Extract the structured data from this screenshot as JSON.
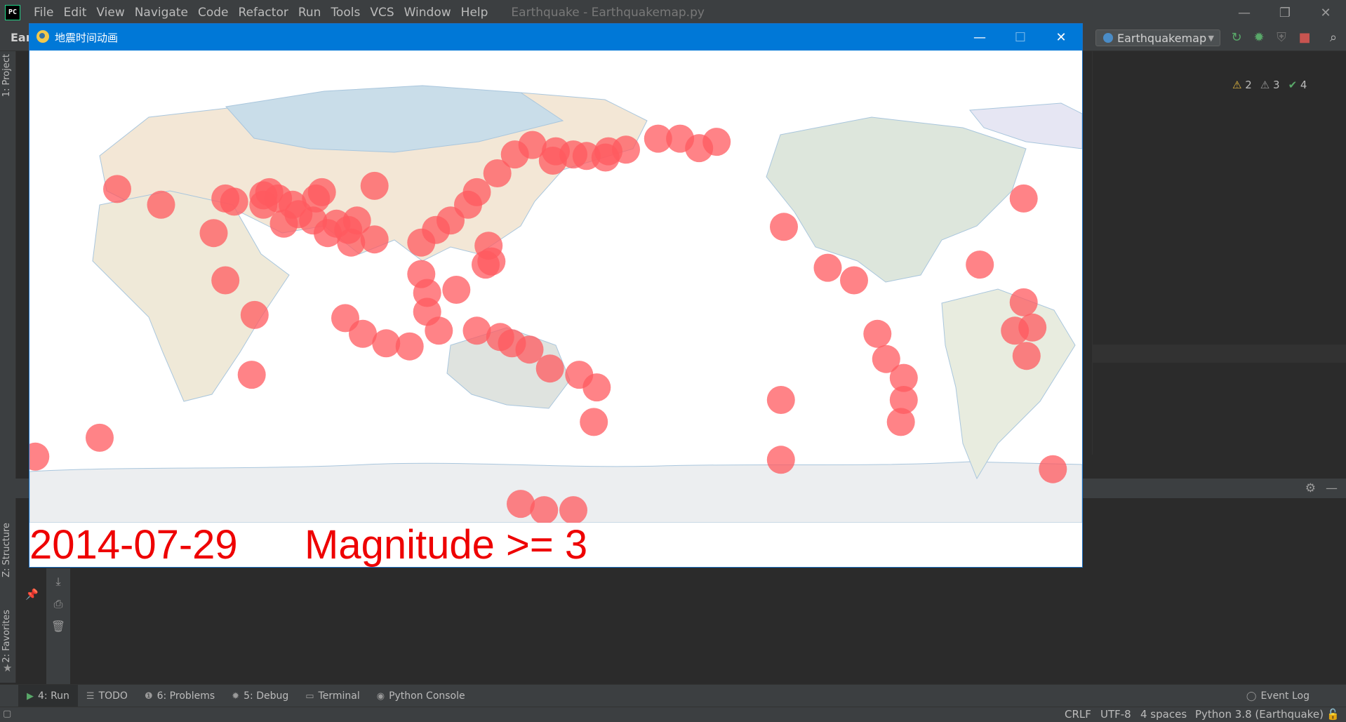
{
  "ide": {
    "menus": [
      "File",
      "Edit",
      "View",
      "Navigate",
      "Code",
      "Refactor",
      "Run",
      "Tools",
      "VCS",
      "Window",
      "Help"
    ],
    "window_title": "Earthquake - Earthquakemap.py",
    "project_crumb": "Ear",
    "run_config": "Earthquakemap",
    "inspections": {
      "warnings": "2",
      "weak_warnings": "3",
      "typos": "4"
    },
    "left_tabs": {
      "project": "1: Project",
      "structure": "Z: Structure",
      "favorites": "2: Favorites"
    },
    "tool_windows": [
      {
        "icon": "run-icon",
        "glyph": "▶",
        "label": "4: Run",
        "active": true
      },
      {
        "icon": "todo-icon",
        "glyph": "☰",
        "label": "TODO",
        "active": false
      },
      {
        "icon": "problems-icon",
        "glyph": "❶",
        "label": "6: Problems",
        "active": false
      },
      {
        "icon": "debug-icon",
        "glyph": "✹",
        "label": "5: Debug",
        "active": false
      },
      {
        "icon": "terminal-icon",
        "glyph": "▭",
        "label": "Terminal",
        "active": false
      },
      {
        "icon": "python-console-icon",
        "glyph": "◉",
        "label": "Python Console",
        "active": false
      }
    ],
    "event_log": "Event Log",
    "status": {
      "line_sep": "CRLF",
      "encoding": "UTF-8",
      "indent": "4 spaces",
      "interpreter": "Python 3.8 (Earthquake)"
    }
  },
  "animation": {
    "window_title": "地震时间动画",
    "date_label": "2014-07-29",
    "magnitude_label": "Magnitude >= 3",
    "marker_color": "#ff5a5f",
    "quakes": [
      {
        "lat": 53,
        "lon": 170
      },
      {
        "lat": 51.5,
        "lon": -179.5
      },
      {
        "lat": 52,
        "lon": 176
      },
      {
        "lat": 51,
        "lon": -173
      },
      {
        "lat": 53.5,
        "lon": -166
      },
      {
        "lat": 53,
        "lon": -172
      },
      {
        "lat": 57,
        "lon": -155
      },
      {
        "lat": 57,
        "lon": -147.5
      },
      {
        "lat": 54,
        "lon": -141
      },
      {
        "lat": 56,
        "lon": -135
      },
      {
        "lat": 46,
        "lon": 150
      },
      {
        "lat": 52,
        "lon": 156
      },
      {
        "lat": 40,
        "lon": 143
      },
      {
        "lat": 36,
        "lon": 140
      },
      {
        "lat": 31,
        "lon": 134
      },
      {
        "lat": 28,
        "lon": 129
      },
      {
        "lat": 24,
        "lon": 124
      },
      {
        "lat": 23,
        "lon": 147
      },
      {
        "lat": 17,
        "lon": 146
      },
      {
        "lat": 18,
        "lon": 148
      },
      {
        "lat": 14,
        "lon": 124
      },
      {
        "lat": 8,
        "lon": 126
      },
      {
        "lat": 2,
        "lon": 126
      },
      {
        "lat": 9,
        "lon": 136
      },
      {
        "lat": 0,
        "lon": 98
      },
      {
        "lat": -5,
        "lon": 104
      },
      {
        "lat": -8,
        "lon": 112
      },
      {
        "lat": -9,
        "lon": 120
      },
      {
        "lat": -4,
        "lon": 130
      },
      {
        "lat": -4,
        "lon": 143
      },
      {
        "lat": -6,
        "lon": 151
      },
      {
        "lat": -8,
        "lon": 155
      },
      {
        "lat": -10,
        "lon": 161
      },
      {
        "lat": -16,
        "lon": 168
      },
      {
        "lat": -18,
        "lon": 178
      },
      {
        "lat": -22,
        "lon": -176
      },
      {
        "lat": -33,
        "lon": -177
      },
      {
        "lat": 40,
        "lon": 72
      },
      {
        "lat": 39,
        "lon": 70
      },
      {
        "lat": 38,
        "lon": 75
      },
      {
        "lat": 36,
        "lon": 70
      },
      {
        "lat": 36,
        "lon": 80
      },
      {
        "lat": 33,
        "lon": 82
      },
      {
        "lat": 31,
        "lon": 87
      },
      {
        "lat": 38,
        "lon": 88
      },
      {
        "lat": 40,
        "lon": 90
      },
      {
        "lat": 30,
        "lon": 95
      },
      {
        "lat": 31,
        "lon": 102
      },
      {
        "lat": 28,
        "lon": 99
      },
      {
        "lat": 27,
        "lon": 92
      },
      {
        "lat": 24,
        "lon": 100
      },
      {
        "lat": 25,
        "lon": 108
      },
      {
        "lat": 42,
        "lon": 108
      },
      {
        "lat": 30,
        "lon": 77
      },
      {
        "lat": 38,
        "lon": 57
      },
      {
        "lat": 37,
        "lon": 60
      },
      {
        "lat": 41,
        "lon": 20
      },
      {
        "lat": 36,
        "lon": 35
      },
      {
        "lat": 27,
        "lon": 53
      },
      {
        "lat": 12,
        "lon": 57
      },
      {
        "lat": 1,
        "lon": 67
      },
      {
        "lat": -18,
        "lon": 66
      },
      {
        "lat": 5,
        "lon": -30
      },
      {
        "lat": -3,
        "lon": -27
      },
      {
        "lat": -12,
        "lon": -29
      },
      {
        "lat": -38,
        "lon": 14
      },
      {
        "lat": -44,
        "lon": -8
      },
      {
        "lat": -48,
        "lon": -20
      },
      {
        "lat": -59,
        "lon": 158
      },
      {
        "lat": -61,
        "lon": 166
      },
      {
        "lat": -61,
        "lon": 176
      },
      {
        "lat": 29,
        "lon": -112
      },
      {
        "lat": 16,
        "lon": -97
      },
      {
        "lat": 12,
        "lon": -88
      },
      {
        "lat": -5,
        "lon": -80
      },
      {
        "lat": -13,
        "lon": -77
      },
      {
        "lat": -19,
        "lon": -71
      },
      {
        "lat": -26,
        "lon": -71
      },
      {
        "lat": -33,
        "lon": -72
      },
      {
        "lat": 17,
        "lon": -45
      },
      {
        "lat": 38,
        "lon": -30
      },
      {
        "lat": -4,
        "lon": -33
      },
      {
        "lat": -26,
        "lon": -113
      },
      {
        "lat": -45,
        "lon": -113
      },
      {
        "lat": 50,
        "lon": 169
      },
      {
        "lat": 55,
        "lon": 162
      }
    ]
  }
}
